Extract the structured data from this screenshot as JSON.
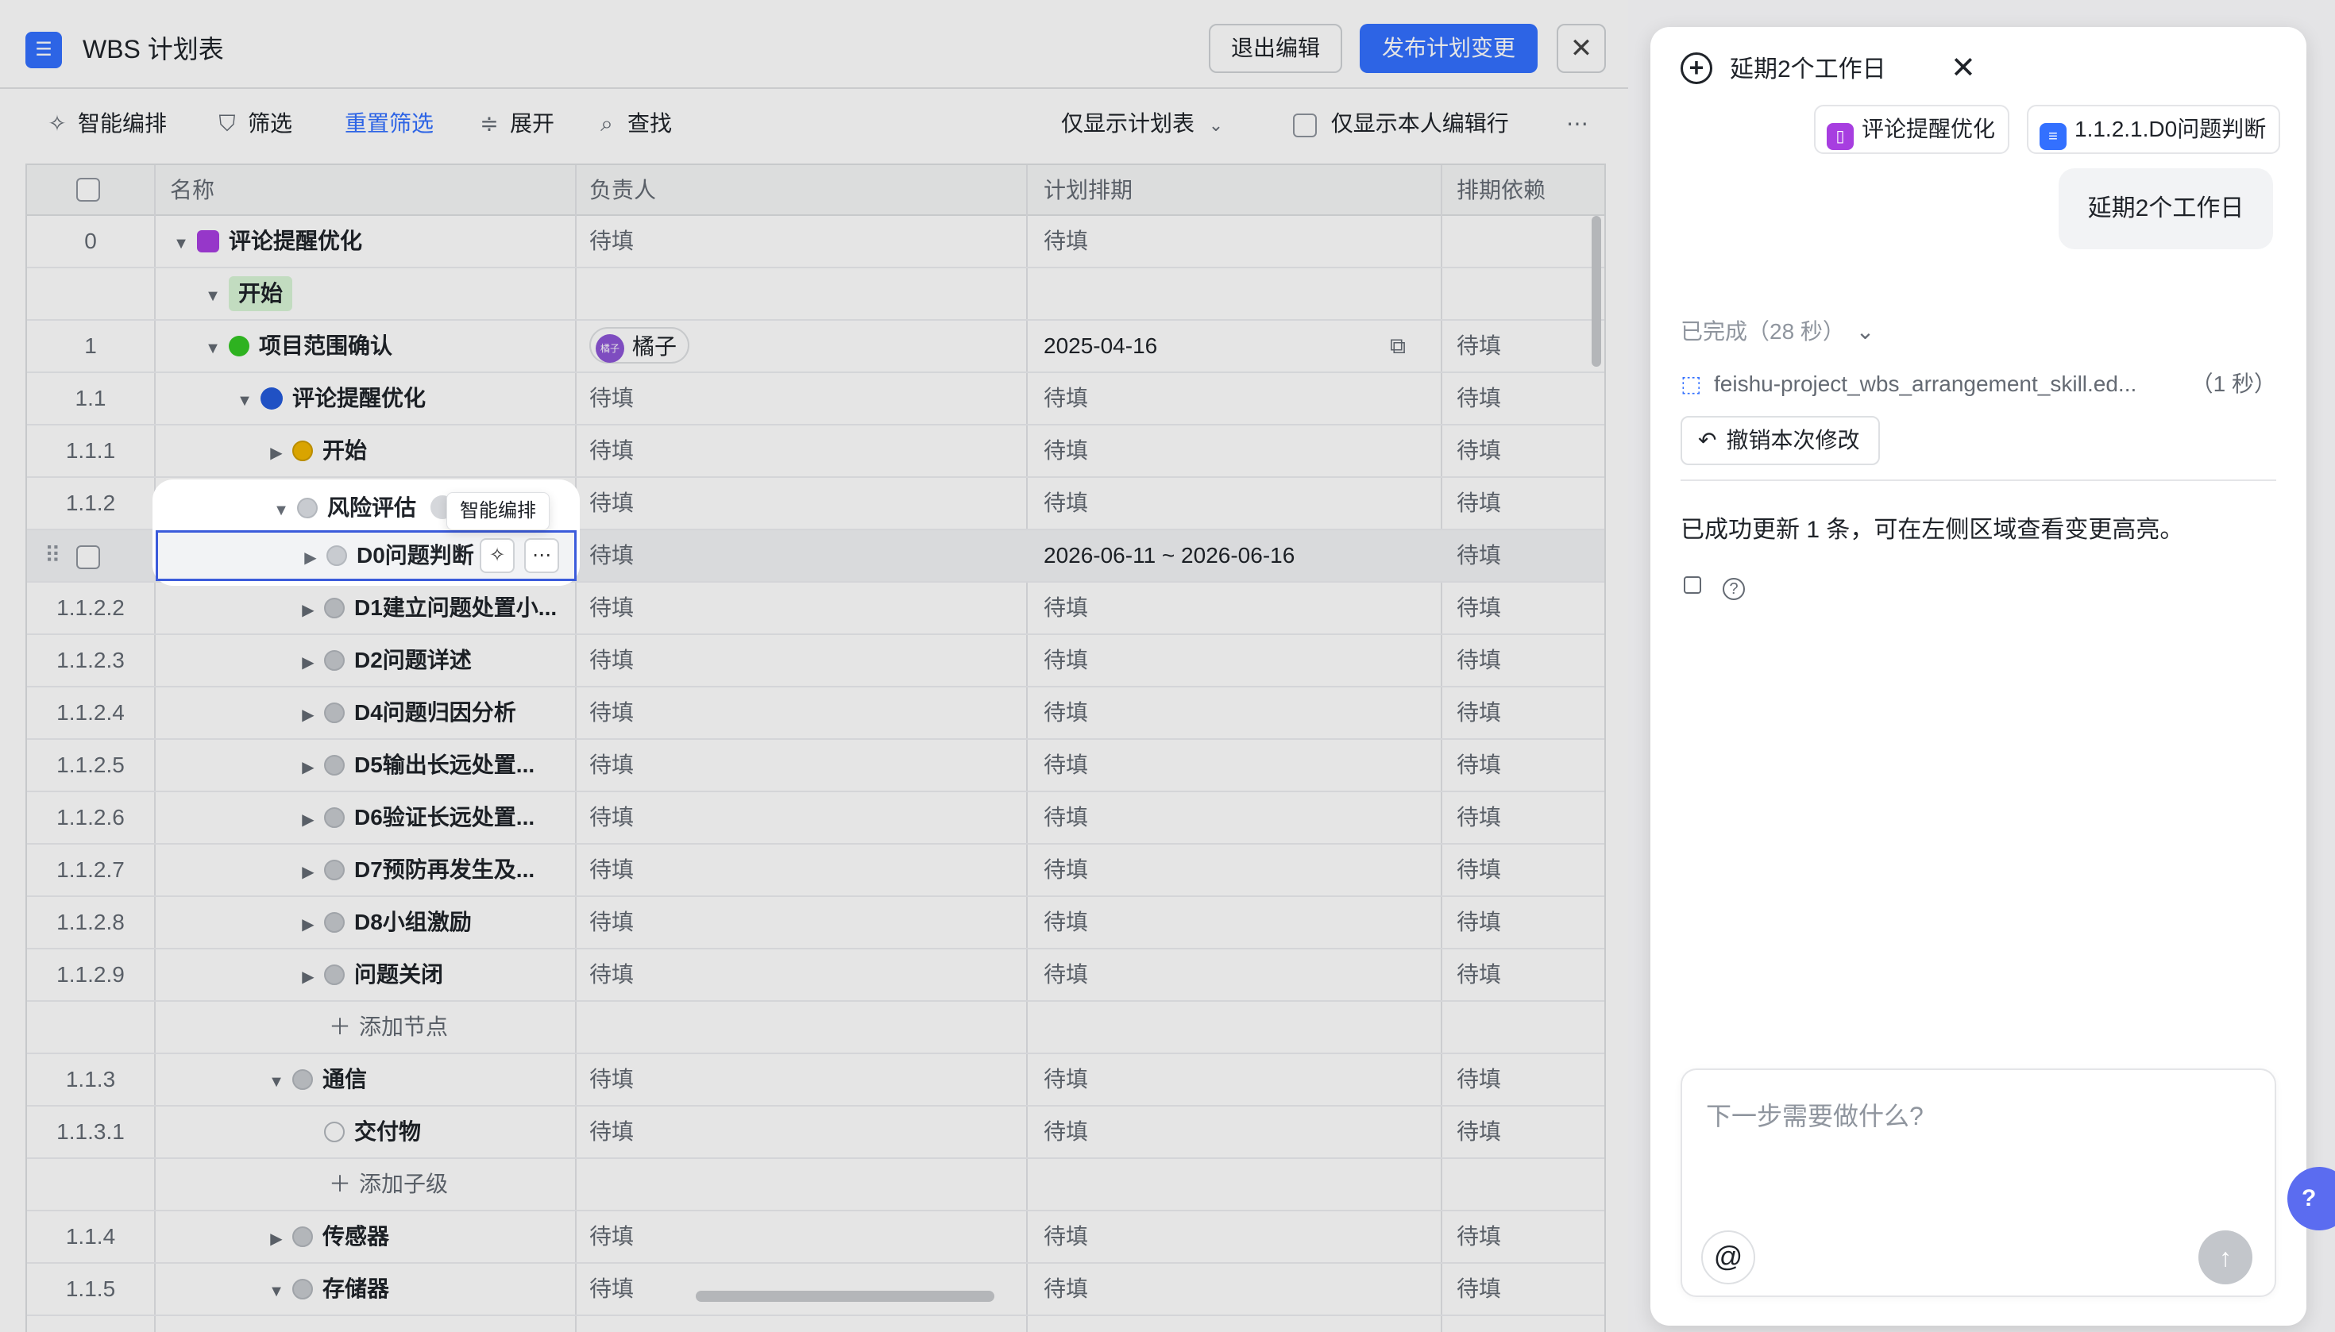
{
  "header": {
    "app_icon": "list-icon",
    "title": "WBS 计划表",
    "exit_label": "退出编辑",
    "publish_label": "发布计划变更",
    "close_icon": "close-icon"
  },
  "toolbar": {
    "smart_label": "智能编排",
    "filter_label": "筛选",
    "reset_label": "重置筛选",
    "expand_label": "展开",
    "find_label": "查找",
    "view_select": "仅显示计划表",
    "own_rows_label": "仅显示本人编辑行",
    "more_icon": "more-icon"
  },
  "table": {
    "columns": [
      "名称",
      "负责人",
      "计划排期",
      "排期依赖"
    ],
    "add_node": "添加节点",
    "add_child": "添加子级",
    "rows": [
      {
        "idx": "0",
        "name": "评论提醒优化",
        "owner": "待填",
        "sched": "待填",
        "dep": ""
      },
      {
        "idx": "",
        "name": "开始",
        "owner": "",
        "sched": "",
        "dep": ""
      },
      {
        "idx": "1",
        "name": "项目范围确认",
        "owner": "橘子",
        "avatar": "橘子",
        "sched": "2025-04-16",
        "dep": "待填"
      },
      {
        "idx": "1.1",
        "name": "评论提醒优化",
        "owner": "待填",
        "sched": "待填",
        "dep": "待填"
      },
      {
        "idx": "1.1.1",
        "name": "开始",
        "owner": "待填",
        "sched": "待填",
        "dep": "待填"
      },
      {
        "idx": "1.1.2",
        "name": "风险评估",
        "owner": "待填",
        "sched": "待填",
        "dep": "待填"
      },
      {
        "idx": "",
        "name": "D0问题判断",
        "owner": "待填",
        "sched": "2026-06-11 ~ 2026-06-16",
        "dep": "待填"
      },
      {
        "idx": "1.1.2.2",
        "name": "D1建立问题处置小...",
        "owner": "待填",
        "sched": "待填",
        "dep": "待填"
      },
      {
        "idx": "1.1.2.3",
        "name": "D2问题详述",
        "owner": "待填",
        "sched": "待填",
        "dep": "待填"
      },
      {
        "idx": "1.1.2.4",
        "name": "D4问题归因分析",
        "owner": "待填",
        "sched": "待填",
        "dep": "待填"
      },
      {
        "idx": "1.1.2.5",
        "name": "D5输出长远处置...",
        "owner": "待填",
        "sched": "待填",
        "dep": "待填"
      },
      {
        "idx": "1.1.2.6",
        "name": "D6验证长远处置...",
        "owner": "待填",
        "sched": "待填",
        "dep": "待填"
      },
      {
        "idx": "1.1.2.7",
        "name": "D7预防再发生及...",
        "owner": "待填",
        "sched": "待填",
        "dep": "待填"
      },
      {
        "idx": "1.1.2.8",
        "name": "D8小组激励",
        "owner": "待填",
        "sched": "待填",
        "dep": "待填"
      },
      {
        "idx": "1.1.2.9",
        "name": "问题关闭",
        "owner": "待填",
        "sched": "待填",
        "dep": "待填"
      },
      {
        "idx": "1.1.3",
        "name": "通信",
        "owner": "待填",
        "sched": "待填",
        "dep": "待填"
      },
      {
        "idx": "1.1.3.1",
        "name": "交付物",
        "owner": "待填",
        "sched": "待填",
        "dep": "待填"
      },
      {
        "idx": "1.1.4",
        "name": "传感器",
        "owner": "待填",
        "sched": "待填",
        "dep": "待填"
      },
      {
        "idx": "1.1.5",
        "name": "存储器",
        "owner": "待填",
        "sched": "待填",
        "dep": "待填"
      }
    ],
    "tooltip": "智能编排"
  },
  "assistant": {
    "title": "延期2个工作日",
    "context_chips": [
      "评论提醒优化",
      "1.1.2.1.D0问题判断"
    ],
    "user_message": "延期2个工作日",
    "status": "已完成（28 秒）",
    "skill_name": "feishu-project_wbs_arrangement_skill.ed...",
    "skill_time": "（1 秒）",
    "undo_label": "撤销本次修改",
    "reply": "已成功更新 1 条，可在左侧区域查看变更高亮。",
    "composer_placeholder": "下一步需要做什么?"
  },
  "colors": {
    "accent": "#3370ff",
    "purple": "#a73ee0",
    "green": "#34c724",
    "yellow": "#f2b700"
  }
}
